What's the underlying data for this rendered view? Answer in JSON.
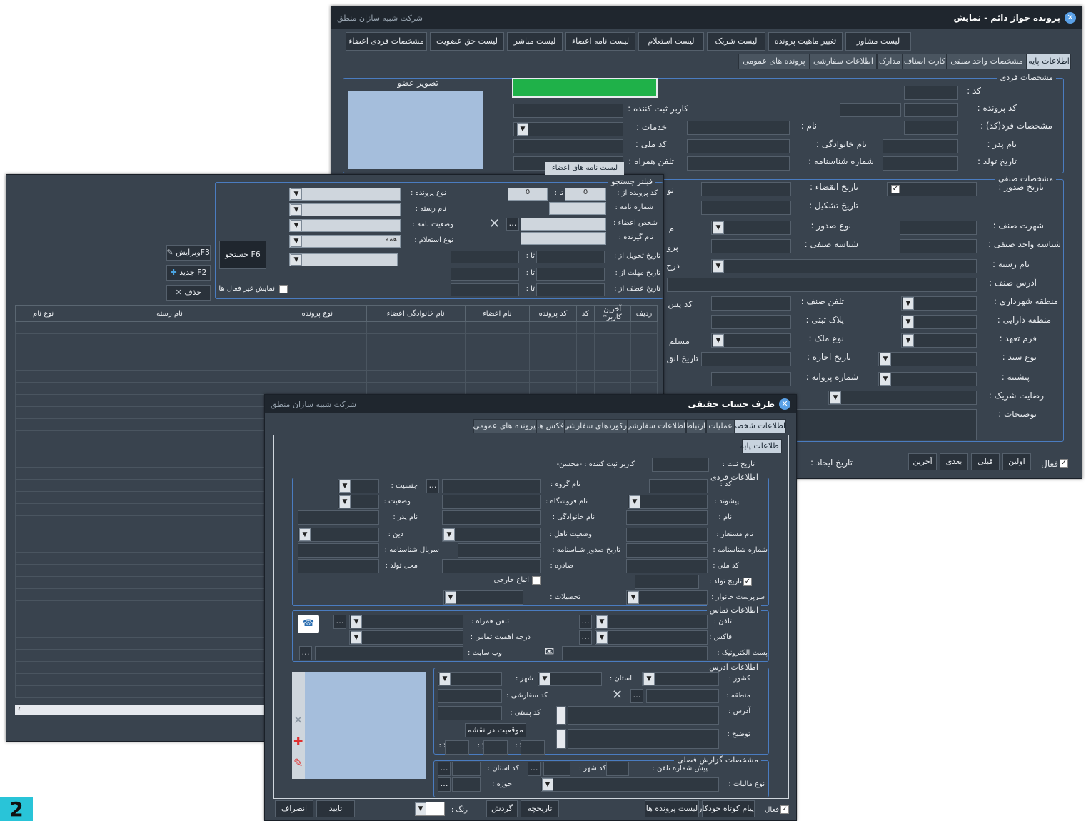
{
  "win1": {
    "title": "پرونده جواز دائم - نمایش",
    "company": "شرکت شبیه سازان منطق",
    "top_buttons": [
      "لیست مشاور",
      "تغییر ماهیت پرونده",
      "لیست شریک",
      "لیست استعلام",
      "لیست نامه اعضاء",
      "لیست مباشر",
      "لیست حق عضویت",
      "مشخصات فردی اعضاء"
    ],
    "tabs": [
      "اطلاعات پایه",
      "مشخصات واحد صنفی",
      "کارت اصناف",
      "مدارک",
      "اطلاعات سفارشی",
      "پرونده های عمومی"
    ],
    "grp_personal": "مشخصات فردی",
    "grp_unit": "مشخصات صنفی",
    "photo_label": "تصویر عضو",
    "labels": {
      "code": "کد :",
      "case_code": "کد پرونده :",
      "person_code": "مشخصات فرد(کد) :",
      "father": "نام پدر :",
      "birth": "تاریخ تولد :",
      "registrar": "کاربر ثبت کننده :",
      "services": "خدمات :",
      "national": "کد ملی :",
      "mobile": "تلفن همراه :",
      "name": "نام :",
      "family": "نام خانوادگی :",
      "idno": "شماره شناسنامه :",
      "issue": "تاریخ صدور :",
      "expire": "تاریخ انقضاء :",
      "formed": "تاریخ تشکیل :",
      "guild_fame": "شهرت صنف :",
      "issue_type": "نوع صدور :",
      "unit_id": "شناسه واحد صنفی :",
      "guild_id": "شناسه صنفی :",
      "field": "نام رسته :",
      "guild_addr": "آدرس صنف :",
      "municipal": "منطقه شهرداری :",
      "guild_tel": "تلفن صنف :",
      "tax_region": "منطقه دارایی :",
      "plate": "پلاک ثبتی :",
      "commit": "فرم تعهد :",
      "property": "نوع ملک :",
      "doc_type": "نوع سند :",
      "lease": "تاریخ اجاره :",
      "prior": "پیشینه :",
      "license_no": "شماره پروانه :",
      "partner": "رضایت شریک :",
      "notes": "توضیحات :",
      "created": "تاریخ ایجاد :"
    },
    "frag": {
      "no": "نو",
      "ma": "م",
      "pro": "پرو",
      "deg": "درج",
      "post": "کد پس",
      "mos": "مسلم",
      "expshort": "تاریخ انق"
    },
    "nav": [
      "فعال",
      "اولین",
      "قبلی",
      "بعدی",
      "آخرین"
    ],
    "member_letters_tip": "لیست نامه های اعضاء"
  },
  "win2": {
    "filter_title": "فیلتر جستجو",
    "labels": {
      "case_from": "کد پرونده از :",
      "to": "تا :",
      "letter_no": "شماره نامه :",
      "member": "شخص اعضاء :",
      "recipient": "نام گیرنده :",
      "deliver": "تاریخ تحویل از :",
      "deadline": "تاریخ مهلت از :",
      "ref": "تاریخ عطف از :",
      "case_type": "نوع پرونده :",
      "field": "نام رسته :",
      "letter_status": "وضعیت نامه :",
      "inquiry": "نوع استعلام :",
      "inactive": "نمایش غیر فعال ها"
    },
    "case_from_val": "0",
    "case_to_val": "0",
    "inquiry_val": "همه",
    "buttons": {
      "search": "F6 جستجو",
      "edit": "F3ویرایش",
      "new": "F2 جدید",
      "delete": "حذف"
    },
    "columns": [
      "ردیف",
      "آخرین کاربر*",
      "کد",
      "کد پرونده",
      "نام اعضاء",
      "نام خانوادگی اعضاء",
      "نوع پرونده",
      "نام رسته",
      "نوع نام"
    ]
  },
  "win3": {
    "title": "طرف حساب حقیقی",
    "company": "شرکت شبیه سازان منطق",
    "tabs": [
      "اطلاعات شخصی",
      "عملیات",
      "ارتباط",
      "اطلاعات سفارشی",
      "رکوردهای سفارشی",
      "فکس ها",
      "پرونده های عمومی"
    ],
    "subtab": "اطلاعات پایه",
    "reg_date": "تاریخ ثبت :",
    "registrar": "کاربر ثبت کننده : -محسن-",
    "grp_personal": "اطلاعات فردی",
    "grp_contact": "اطلاعات تماس",
    "grp_address": "اطلاعات آدرس",
    "grp_season": "مشخصات گزارش فصلی",
    "labels": {
      "code": "کد :",
      "prefix": "پیشوند :",
      "name": "نام :",
      "alias": "نام مستعار :",
      "idno": "شماره شناسنامه :",
      "national": "کد ملی :",
      "birth": "تاریخ تولد :",
      "head": "سرپرست خانوار :",
      "group": "نام گروه :",
      "shop": "نام فروشگاه :",
      "family": "نام خانوادگی :",
      "marital": "وضعیت تاهل :",
      "id_issue": "تاریخ صدور شناسنامه :",
      "issued": "صادره :",
      "foreign": "اتباع خارجی",
      "edu": "تحصیلات :",
      "gender": "جنسیت :",
      "status": "وضعیت :",
      "father": "نام پدر :",
      "religion": "دین :",
      "serial": "سریال شناسنامه :",
      "birthplace": "محل تولد :",
      "tel": "تلفن :",
      "fax": "فاکس :",
      "email": "پست الکترونیک :",
      "mobile": "تلفن همراه :",
      "priority": "درجه اهمیت تماس :",
      "web": "وب سایت :",
      "country": "کشور :",
      "province": "استان :",
      "city": "شهر :",
      "region": "منطقه :",
      "custom_code": "کد سفارشی :",
      "address": "آدرس :",
      "postal": "کد پستی :",
      "desc": "توضیح :",
      "map": "موقعیت در نقشه",
      "x": "x :",
      "y": "y :",
      "z": "z :",
      "pre_tel": "پیش شماره تلفن :",
      "city_code": "کد شهر :",
      "prov_code": "کد استان :",
      "zone": "حوزه :",
      "tax_type": "نوع مالیات :",
      "color": "رنگ :"
    },
    "bottom": [
      "فعال",
      "پیام کوتاه خودکار",
      "لیست پرونده ها",
      "تاریخچه",
      "گردش",
      "تایید",
      "انصراف"
    ]
  },
  "badge": "2"
}
